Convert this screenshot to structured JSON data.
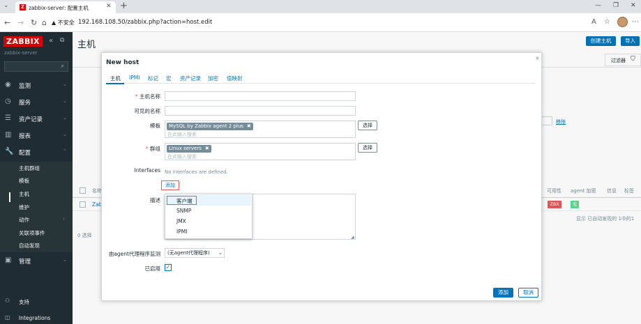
{
  "browser": {
    "tab_title": "zabbix-server: 配置主机",
    "tab_favicon": "Z",
    "new_tab": "+",
    "security_label": "▲ 不安全",
    "url": "192.168.108.50/zabbix.php?action=host.edit",
    "icons": [
      "back-icon",
      "forward-icon",
      "reload-icon",
      "home-icon",
      "reader-icon",
      "favorite-icon",
      "profile-icon"
    ]
  },
  "sidebar": {
    "logo": "ZABBIX",
    "server": "zabbix-server",
    "menu": [
      {
        "label": "监测",
        "icon": "eye-icon"
      },
      {
        "label": "服务",
        "icon": "clock-icon"
      },
      {
        "label": "资产记录",
        "icon": "list-icon"
      },
      {
        "label": "报表",
        "icon": "report-icon"
      },
      {
        "label": "配置",
        "icon": "wrench-icon"
      }
    ],
    "submenu": [
      "主机群组",
      "模板",
      "主机",
      "维护",
      "动作",
      "关联项事件",
      "自动发现"
    ],
    "admin": {
      "label": "管理",
      "icon": "admin-icon"
    },
    "support": "支持",
    "integrations": "Integrations"
  },
  "page": {
    "title": "主机",
    "create_button": "创建主机",
    "import_button": "导入",
    "filter_label": "过滤器",
    "remove_link": "移除",
    "table_headers": {
      "name": "名称",
      "availability": "可用性",
      "agent_encryption": "agent 加密",
      "info": "信息",
      "tags": "标签"
    },
    "row_name_partial": "Zab",
    "zbx_badge": "ZBX",
    "encryption_badge": "无",
    "display_text": "显示 已自动发现的 1中的1",
    "selected_count": "0 选择"
  },
  "modal": {
    "title": "New host",
    "tabs": [
      "主机",
      "IPMI",
      "标记",
      "宏",
      "资产记录",
      "加密",
      "值映射"
    ],
    "active_tab": "主机",
    "fields": {
      "host_name_label": "主机名称",
      "visible_name_label": "可见的名称",
      "templates_label": "模板",
      "groups_label": "群组",
      "interfaces_label": "Interfaces",
      "description_label": "描述",
      "proxy_label": "由agent代理程序监测",
      "enabled_label": "已启用"
    },
    "required_mark": "*",
    "template_tag": "MySQL by Zabbix agent 2 plus",
    "group_tag": "Linux servers",
    "tag_remove": "✖",
    "search_placeholder": "在此输入搜索",
    "select_button": "选择",
    "no_interfaces": "No interfaces are defined.",
    "add_interface_button": "添加",
    "interface_options": [
      "客户端",
      "SNMP",
      "JMX",
      "IPMI"
    ],
    "proxy_value": "(无agent代理程序)",
    "enabled_checked": true,
    "add_button": "添加",
    "cancel_button": "取消",
    "close_mark": "×"
  }
}
